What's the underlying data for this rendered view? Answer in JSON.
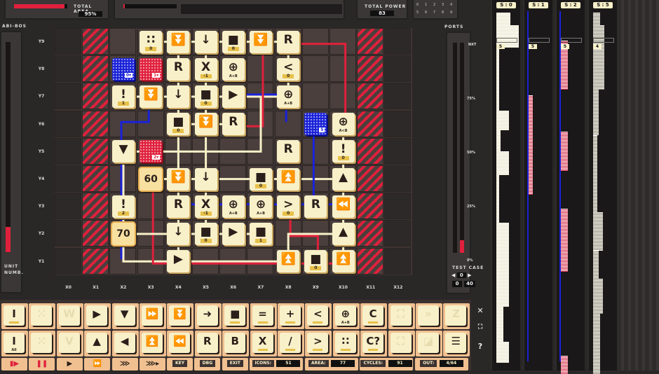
{
  "header": {
    "total_area_label": "TOTAL AREA",
    "total_area_value": "95%",
    "total_area_fill": 0.95,
    "power_fill": 0.02,
    "total_power_label": "TOTAL POWER",
    "total_power_value": "83",
    "dial_labels": [
      "0",
      "1",
      "2",
      "3",
      "4",
      "5",
      "6",
      "7",
      "8",
      "9"
    ]
  },
  "left_panel": {
    "title": "ABI-BOS",
    "unit_label": "UNIT NUMB.",
    "level": 2
  },
  "grid": {
    "rows": [
      "Y9",
      "Y8",
      "Y7",
      "Y6",
      "Y5",
      "Y4",
      "Y3",
      "Y2",
      "Y1"
    ],
    "cols": [
      "X0",
      "X1",
      "X2",
      "X3",
      "X4",
      "X5",
      "X6",
      "X7",
      "X8",
      "X9",
      "X10",
      "X11",
      "X12"
    ],
    "hatched_cols": [
      "X1",
      "X11"
    ],
    "dark_cols": [
      "X0",
      "X12"
    ],
    "tiles": [
      {
        "c": "X3",
        "r": "Y9",
        "g": "∷",
        "s": "0"
      },
      {
        "c": "X4",
        "r": "Y9",
        "g": "⏬"
      },
      {
        "c": "X5",
        "r": "Y9",
        "g": "↓"
      },
      {
        "c": "X6",
        "r": "Y9",
        "g": "■",
        "s": "0"
      },
      {
        "c": "X7",
        "r": "Y9",
        "g": "⏬"
      },
      {
        "c": "X8",
        "r": "Y9",
        "g": "R"
      },
      {
        "c": "X2",
        "r": "Y8",
        "t": "portb",
        "p": "0▾"
      },
      {
        "c": "X3",
        "r": "Y8",
        "t": "portr",
        "p": "1▾"
      },
      {
        "c": "X4",
        "r": "Y8",
        "g": "R"
      },
      {
        "c": "X5",
        "r": "Y8",
        "g": "X",
        "s": "-1"
      },
      {
        "c": "X6",
        "r": "Y8",
        "g": "⊕",
        "n": "A+B"
      },
      {
        "c": "X8",
        "r": "Y8",
        "g": "<",
        "s": "0"
      },
      {
        "c": "X2",
        "r": "Y7",
        "g": "!",
        "s": "1"
      },
      {
        "c": "X3",
        "r": "Y7",
        "g": "⏬"
      },
      {
        "c": "X4",
        "r": "Y7",
        "g": "↓"
      },
      {
        "c": "X5",
        "r": "Y7",
        "g": "■",
        "s": "0"
      },
      {
        "c": "X6",
        "r": "Y7",
        "g": "▶"
      },
      {
        "c": "X8",
        "r": "Y7",
        "g": "⊕",
        "n": "A+B"
      },
      {
        "c": "X4",
        "r": "Y6",
        "g": "■",
        "s": "0"
      },
      {
        "c": "X5",
        "r": "Y6",
        "g": "⏬"
      },
      {
        "c": "X6",
        "r": "Y6",
        "g": "R"
      },
      {
        "c": "X9",
        "r": "Y6",
        "t": "portb",
        "p": "5"
      },
      {
        "c": "X10",
        "r": "Y6",
        "g": "⊕",
        "n": "A<B"
      },
      {
        "c": "X2",
        "r": "Y5",
        "g": "▼"
      },
      {
        "c": "X3",
        "r": "Y5",
        "t": "portr",
        "p": "2▾"
      },
      {
        "c": "X8",
        "r": "Y5",
        "g": "R"
      },
      {
        "c": "X10",
        "r": "Y5",
        "g": "!",
        "s": "0"
      },
      {
        "c": "X3",
        "r": "Y4",
        "t": "num",
        "g": "60"
      },
      {
        "c": "X4",
        "r": "Y4",
        "g": "⏬"
      },
      {
        "c": "X5",
        "r": "Y4",
        "g": "↓"
      },
      {
        "c": "X7",
        "r": "Y4",
        "g": "■",
        "s": "0"
      },
      {
        "c": "X8",
        "r": "Y4",
        "g": "⏫"
      },
      {
        "c": "X10",
        "r": "Y4",
        "g": "▲"
      },
      {
        "c": "X2",
        "r": "Y3",
        "g": "!",
        "s": "2"
      },
      {
        "c": "X4",
        "r": "Y3",
        "g": "R"
      },
      {
        "c": "X5",
        "r": "Y3",
        "g": "X",
        "s": "-1"
      },
      {
        "c": "X6",
        "r": "Y3",
        "g": "⊕",
        "n": "A+B"
      },
      {
        "c": "X7",
        "r": "Y3",
        "g": "⊕",
        "n": "A+B"
      },
      {
        "c": "X8",
        "r": "Y3",
        "g": ">",
        "s": "0"
      },
      {
        "c": "X9",
        "r": "Y3",
        "g": "R"
      },
      {
        "c": "X10",
        "r": "Y3",
        "g": "⏪"
      },
      {
        "c": "X2",
        "r": "Y2",
        "t": "num",
        "g": "70"
      },
      {
        "c": "X4",
        "r": "Y2",
        "g": "↓"
      },
      {
        "c": "X5",
        "r": "Y2",
        "g": "■",
        "s": "0"
      },
      {
        "c": "X6",
        "r": "Y2",
        "g": "▶"
      },
      {
        "c": "X7",
        "r": "Y2",
        "g": "■",
        "s": "1"
      },
      {
        "c": "X10",
        "r": "Y2",
        "g": "▲"
      },
      {
        "c": "X4",
        "r": "Y1",
        "g": "▶"
      },
      {
        "c": "X8",
        "r": "Y1",
        "g": "⏫"
      },
      {
        "c": "X9",
        "r": "Y1",
        "g": "■",
        "s": "0"
      },
      {
        "c": "X10",
        "r": "Y1",
        "g": "⏫"
      }
    ]
  },
  "ports_panel": {
    "title": "PORTS",
    "scale": [
      "NXT",
      "75%",
      "50%",
      "25%",
      "0%"
    ],
    "progress": 0.06,
    "test_case_label": "TEST CASE",
    "test_case": "0",
    "range_from": "0",
    "range_to": "40"
  },
  "palette": {
    "row1": [
      {
        "g": "I",
        "u": 1
      },
      {
        "g": "⁙",
        "f": 1
      },
      {
        "g": "W",
        "f": 1
      },
      {
        "g": "▶"
      },
      {
        "g": "▼"
      },
      {
        "g": "⏩"
      },
      {
        "g": "⏬"
      },
      {
        "g": "➜"
      },
      {
        "g": "■",
        "u": 1
      },
      {
        "g": "=",
        "u": 1
      },
      {
        "g": "+",
        "u": 1
      },
      {
        "g": "<",
        "u": 1
      },
      {
        "g": "⊕",
        "s": "A+B"
      },
      {
        "g": "C",
        "u": 1
      },
      {
        "g": "⛶",
        "f": 1
      },
      {
        "g": "»",
        "f": 1
      },
      {
        "g": "Z",
        "f": 1
      }
    ],
    "row2": [
      {
        "g": "I",
        "s": "All"
      },
      {
        "g": "⁙",
        "f": 1
      },
      {
        "g": "V",
        "f": 1
      },
      {
        "g": "▲"
      },
      {
        "g": "◀"
      },
      {
        "g": "⏫"
      },
      {
        "g": "⏪"
      },
      {
        "g": "R"
      },
      {
        "g": "B"
      },
      {
        "g": "X",
        "u": 1
      },
      {
        "g": "/",
        "u": 1
      },
      {
        "g": ">",
        "u": 1
      },
      {
        "g": "∷",
        "u": 1
      },
      {
        "g": "C?",
        "u": 1
      },
      {
        "g": "⛶",
        "f": 1
      },
      {
        "g": "◪",
        "f": 1
      },
      {
        "g": "☰"
      }
    ]
  },
  "controls": {
    "play": [
      "▮▶",
      "❚❚",
      "▶",
      "⏩",
      "⋙",
      "⋙▸"
    ],
    "key": "KEY",
    "dbg": "DBG",
    "exit": "EXIT",
    "icons_label": "ICONS:",
    "icons": "51",
    "area_label": "AREA:",
    "area": "77",
    "cycles_label": "CYCLES:",
    "cycles": "91",
    "out_label": "OUT:",
    "out": "4/64"
  },
  "side_buttons": {
    "close": "✕",
    "fullscreen": "⛶",
    "help": "?"
  },
  "scopes": [
    {
      "label": "S : 0",
      "value": "5",
      "color": "#e8e4c8"
    },
    {
      "label": "S : 1",
      "value": "5",
      "color": "#d0203c"
    },
    {
      "label": "S : 2",
      "value": "5",
      "color": "#d0203c"
    },
    {
      "label": "S : 5",
      "value": "4",
      "color": "#8a8670"
    }
  ],
  "colors": {
    "red": "#e0203c",
    "blue": "#1a22d8",
    "wire": "#f8f0c8",
    "tile": "#f8f0c8"
  }
}
